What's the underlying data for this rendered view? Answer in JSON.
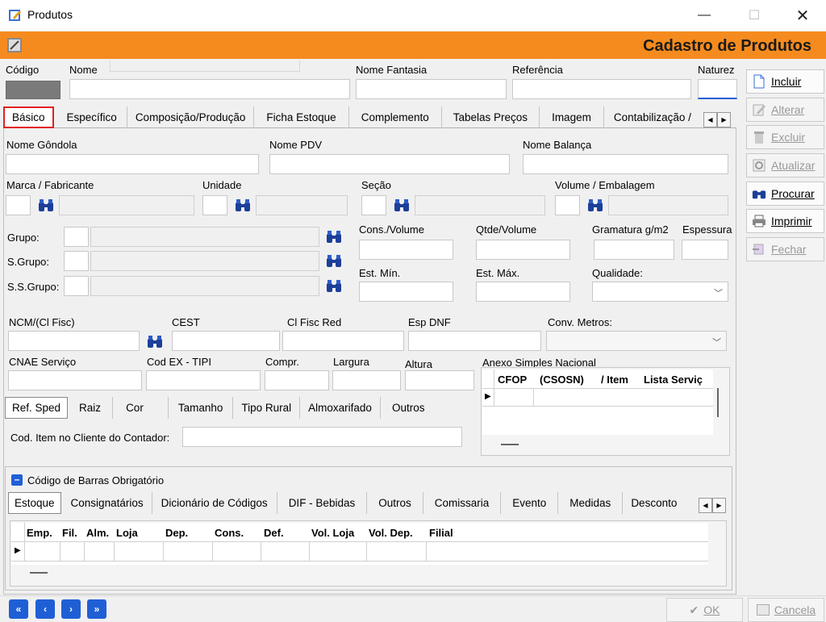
{
  "window": {
    "title": "Produtos"
  },
  "header": {
    "title": "Cadastro de Produtos"
  },
  "top_fields": {
    "codigo": "Código",
    "nome": "Nome",
    "nome_fantasia": "Nome Fantasia",
    "referencia": "Referência",
    "natureza": "Naturez"
  },
  "main_tabs": [
    "Básico",
    "Específico",
    "Composição/Produção",
    "Ficha Estoque",
    "Complemento",
    "Tabelas Preços",
    "Imagem",
    "Contabilização /"
  ],
  "basic": {
    "nome_gondola": "Nome Gôndola",
    "nome_pdv": "Nome PDV",
    "nome_balanca": "Nome Balança",
    "marca": "Marca / Fabricante",
    "unidade": "Unidade",
    "secao": "Seção",
    "volume": "Volume / Embalagem",
    "grupo": "Grupo:",
    "sgrupo": "S.Grupo:",
    "ssgrupo": "S.S.Grupo:",
    "cons_volume": "Cons./Volume",
    "qtde_volume": "Qtde/Volume",
    "gramatura": "Gramatura g/m2",
    "espessura": "Espessura",
    "est_min": "Est. Mín.",
    "est_max": "Est. Máx.",
    "qualidade": "Qualidade:",
    "ncm": "NCM/(Cl Fisc)",
    "cest": "CEST",
    "cl_fisc_red": "Cl Fisc Red",
    "esp_dnf": "Esp DNF",
    "conv_metros": "Conv. Metros:",
    "cnae": "CNAE Serviço",
    "cod_ex": "Cod EX - TIPI",
    "compr": "Compr.",
    "largura": "Largura",
    "altura": "Altura",
    "anexo": "Anexo Simples Nacional",
    "anexo_cols": [
      "CFOP",
      "(CSOSN)",
      "/ Item",
      "Lista Serviç"
    ],
    "cod_item": "Cod. Item no Cliente do Contador:"
  },
  "sub_tabs": [
    "Ref. Sped",
    "Raiz",
    "Cor",
    "Tamanho",
    "Tipo Rural",
    "Almoxarifado",
    "Outros"
  ],
  "barcode": {
    "label": "Código de Barras Obrigatório"
  },
  "bottom_tabs": [
    "Estoque",
    "Consignatários",
    "Dicionário de Códigos",
    "DIF - Bebidas",
    "Outros",
    "Comissaria",
    "Evento",
    "Medidas",
    "Desconto"
  ],
  "bottom_cols": [
    "Emp.",
    "Fil.",
    "Alm.",
    "Loja",
    "Dep.",
    "Cons.",
    "Def.",
    "Vol. Loja",
    "Vol. Dep.",
    "Filial"
  ],
  "side_buttons": [
    {
      "label": "Incluir",
      "enabled": true,
      "icon": "document-icon"
    },
    {
      "label": "Alterar",
      "enabled": false,
      "icon": "pencil-icon"
    },
    {
      "label": "Excluir",
      "enabled": false,
      "icon": "trash-icon"
    },
    {
      "label": "Atualizar",
      "enabled": false,
      "icon": "refresh-icon"
    },
    {
      "label": "Procurar",
      "enabled": true,
      "icon": "binoculars-icon"
    },
    {
      "label": "Imprimir",
      "enabled": true,
      "icon": "printer-icon"
    },
    {
      "label": "Fechar",
      "enabled": false,
      "icon": "close-door-icon"
    }
  ],
  "footer": {
    "ok": "OK",
    "cancel": "Cancela"
  },
  "colors": {
    "accent": "#f58b1e",
    "highlight": "#e02020",
    "nav": "#1f5fd6"
  }
}
